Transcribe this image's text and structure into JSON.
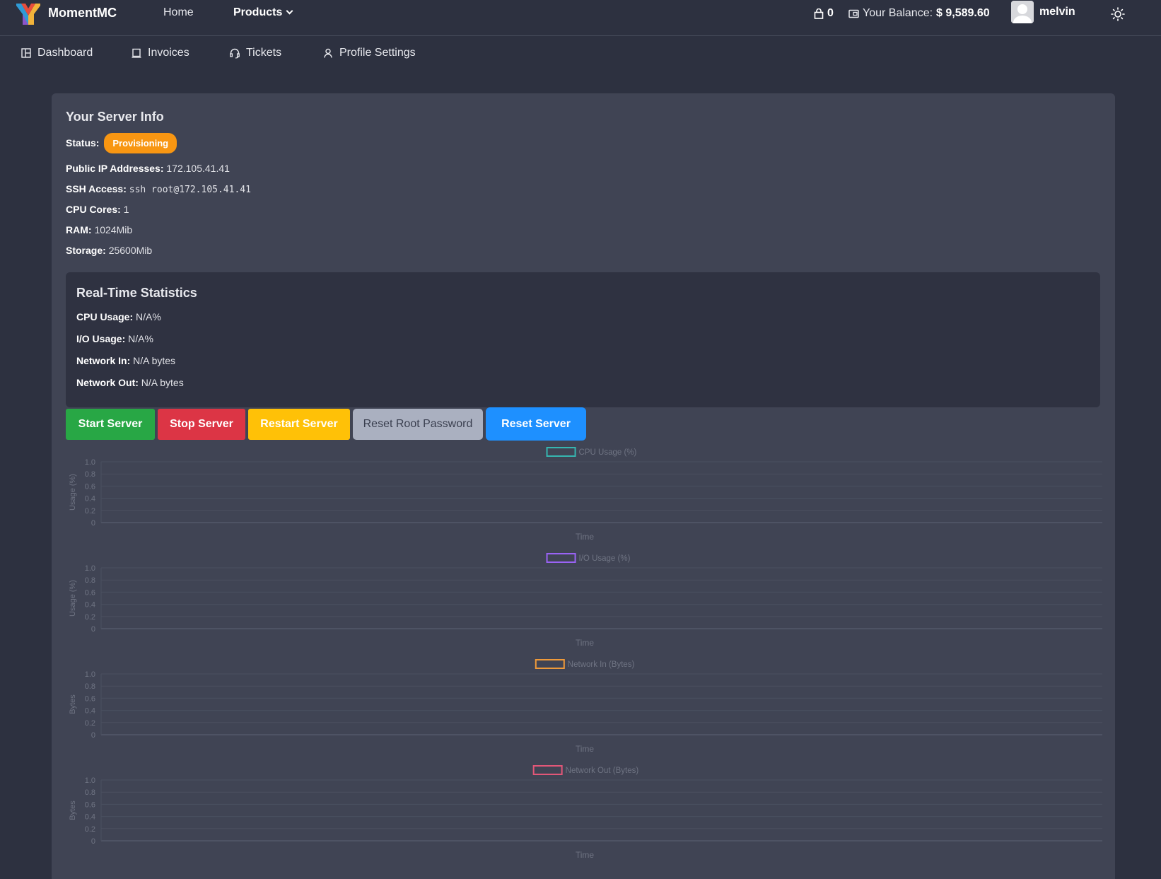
{
  "brand": {
    "name": "MomentMC"
  },
  "topnav": {
    "home": "Home",
    "products": "Products",
    "cart_count": "0",
    "balance_label": "Your Balance:",
    "balance_value": "$ 9,589.60",
    "username": "melvin"
  },
  "subnav": {
    "dashboard": "Dashboard",
    "invoices": "Invoices",
    "tickets": "Tickets",
    "profile": "Profile Settings"
  },
  "server": {
    "title": "Your Server Info",
    "status_label": "Status:",
    "status_value": "Provisioning",
    "ip_label": "Public IP Addresses:",
    "ip_value": "172.105.41.41",
    "ssh_label": "SSH Access:",
    "ssh_value": "ssh root@172.105.41.41",
    "cpu_label": "CPU Cores:",
    "cpu_value": "1",
    "ram_label": "RAM:",
    "ram_value": "1024Mib",
    "storage_label": "Storage:",
    "storage_value": "25600Mib"
  },
  "stats": {
    "title": "Real-Time Statistics",
    "cpu_label": "CPU Usage:",
    "cpu_value": "N/A%",
    "io_label": "I/O Usage:",
    "io_value": "N/A%",
    "net_in_label": "Network In:",
    "net_in_value": "N/A bytes",
    "net_out_label": "Network Out:",
    "net_out_value": "N/A bytes"
  },
  "buttons": {
    "start": "Start Server",
    "stop": "Stop Server",
    "restart": "Restart Server",
    "reset_password": "Reset Root Password",
    "reset": "Reset Server"
  },
  "colors": {
    "status_badge": "#f89612",
    "start": "#28a745",
    "stop": "#dc3545",
    "restart": "#ffc107",
    "reset": "#1e90ff"
  },
  "chart_data": [
    {
      "type": "line",
      "series": [
        {
          "name": "CPU Usage (%)",
          "color": "#36b5b0",
          "values": []
        }
      ],
      "xlabel": "Time",
      "ylabel": "Usage (%)",
      "ylim": [
        0,
        1
      ],
      "yticks": [
        "1.0",
        "0.8",
        "0.6",
        "0.4",
        "0.2",
        "0"
      ],
      "legend": "top-center",
      "grid": true
    },
    {
      "type": "line",
      "series": [
        {
          "name": "I/O Usage (%)",
          "color": "#9a63f5",
          "values": []
        }
      ],
      "xlabel": "Time",
      "ylabel": "Usage (%)",
      "ylim": [
        0,
        1
      ],
      "yticks": [
        "1.0",
        "0.8",
        "0.6",
        "0.4",
        "0.2",
        "0"
      ],
      "legend": "top-center",
      "grid": true
    },
    {
      "type": "line",
      "series": [
        {
          "name": "Network In (Bytes)",
          "color": "#ef9a3a",
          "values": []
        }
      ],
      "xlabel": "Time",
      "ylabel": "Bytes",
      "ylim": [
        0,
        1
      ],
      "yticks": [
        "1.0",
        "0.8",
        "0.6",
        "0.4",
        "0.2",
        "0"
      ],
      "legend": "top-center",
      "grid": true
    },
    {
      "type": "line",
      "series": [
        {
          "name": "Network Out (Bytes)",
          "color": "#e25778",
          "values": []
        }
      ],
      "xlabel": "Time",
      "ylabel": "Bytes",
      "ylim": [
        0,
        1
      ],
      "yticks": [
        "1.0",
        "0.8",
        "0.6",
        "0.4",
        "0.2",
        "0"
      ],
      "legend": "top-center",
      "grid": true
    }
  ]
}
